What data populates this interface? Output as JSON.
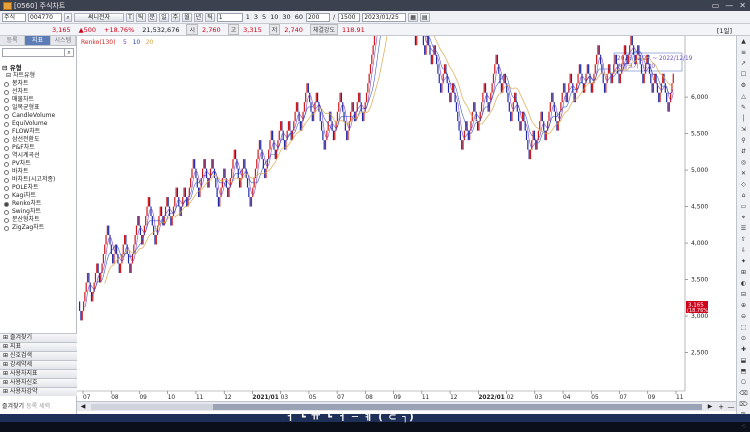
{
  "window": {
    "title": "[0560] 주식차트",
    "icon": "app-icon",
    "controls": [
      "▭",
      "—",
      "✕"
    ]
  },
  "toolbar1": {
    "market": "주식",
    "code": "004770",
    "search_icon": "search-icon",
    "buttons": [
      "T",
      "틱",
      "분",
      "일",
      "주",
      "월",
      "년",
      "틱"
    ],
    "minutes": [
      "1",
      "3",
      "5",
      "10",
      "30",
      "60"
    ],
    "count": "200",
    "total": "1500",
    "date": "2023/01/25"
  },
  "quote": {
    "name": "써니전자",
    "price": "3,165",
    "change": "▲500",
    "change_pct": "+18.76%",
    "volume": "21,532,676",
    "open_label": "시",
    "open": "2,760",
    "high_label": "고",
    "high": "3,315",
    "low_label": "저",
    "low": "2,740",
    "strength_label": "체결강도",
    "strength": "118.91",
    "period": "[1일]"
  },
  "leftpanel": {
    "tabs": [
      "등록",
      "지표",
      "시스템"
    ],
    "active_tab": 1,
    "tree_root": "유형",
    "tree_folder": "차트유형",
    "items": [
      "봉차트",
      "선차트",
      "매물차트",
      "일목균형표",
      "CandleVolume",
      "EquiVolume",
      "FLOW차트",
      "삼선전환도",
      "P&F차트",
      "역시계곡선",
      "PV차트",
      "바차트",
      "바차트(시고저종)",
      "POLE차트",
      "Kagi차트",
      "Renko차트",
      "Swing차트",
      "분산형차트",
      "ZigZag차트"
    ],
    "selected_item": "Renko차트",
    "sections": [
      "즐겨찾기",
      "지표",
      "신호검색",
      "강세약세",
      "사용자지표",
      "사용자신호",
      "사용자강약"
    ],
    "bottom_tabs": [
      "즐겨찾기",
      "등록",
      "세력"
    ]
  },
  "chart_data": {
    "type": "renko",
    "legend": [
      {
        "label": "Renko(130)",
        "color": "#cc2222"
      },
      {
        "label": "5",
        "color": "#7a3fc0"
      },
      {
        "label": "10",
        "color": "#1f3fbf"
      },
      {
        "label": "20",
        "color": "#d9a54a"
      }
    ],
    "info_box": {
      "range": "2016/12/27 ~ 2022/12/19",
      "brick_label": "벽돌크기 : 130"
    },
    "brick_size": 130,
    "ylim": [
      2000,
      6700
    ],
    "yticks": [
      "6,000",
      "5,500",
      "5,000",
      "4,500",
      "4,000",
      "3,500",
      "3,000",
      "2,500"
    ],
    "current_price_tag": [
      "3,165",
      "(18.76%)"
    ],
    "xticks": [
      "07",
      "08",
      "09",
      "10",
      "11",
      "12",
      "2021/01",
      "03",
      "05",
      "07",
      "08",
      "09",
      "11",
      "12",
      "2022/01",
      "02",
      "03",
      "04",
      "05",
      "07",
      "09",
      "11"
    ],
    "bold_xticks": [
      "2021/01",
      "2022/01"
    ],
    "moves": [
      -2,
      5,
      -3,
      4,
      -2,
      6,
      -4,
      2,
      -3,
      4,
      -4,
      6,
      -3,
      5,
      -5,
      4,
      -2,
      3,
      -3,
      4,
      -3,
      3,
      -2,
      5,
      -4,
      4,
      -3,
      3,
      -5,
      4,
      -3,
      5,
      -4,
      3,
      -5,
      7,
      -4,
      5,
      -3,
      4,
      -3,
      3,
      -2,
      4,
      -3,
      5,
      -4,
      3,
      -6,
      4,
      -3,
      5,
      -5,
      4,
      -2,
      3,
      -3,
      19,
      -3,
      2,
      -6,
      3,
      -7,
      3,
      -4,
      2,
      -3,
      2,
      -5,
      3,
      -4,
      2,
      -7,
      3,
      -2,
      4,
      -3,
      5,
      -3,
      6,
      -4,
      2,
      -5,
      3,
      -4,
      2,
      -5,
      3,
      -2,
      4,
      -3,
      5,
      -4,
      5,
      -2,
      3,
      -3,
      4,
      -3,
      3,
      -3,
      5,
      -5,
      3,
      -2,
      3,
      -3,
      4,
      -2,
      3,
      -3,
      2,
      -4,
      3,
      -4,
      2,
      -3,
      3,
      -4,
      4
    ]
  },
  "scroll": {
    "left": "◀",
    "right": "▶",
    "zoom_in": "+",
    "zoom_out": "—"
  },
  "rightbar": {
    "icons": [
      "▲",
      "≡",
      "↗",
      "☐",
      "⚙",
      "△",
      "✎",
      "│",
      "⇲",
      "⚲",
      "⇵",
      "◎",
      "✕",
      "◇",
      "⌂",
      "▭",
      "⌖",
      "☰",
      "⇧",
      "⇩",
      "✦",
      "⊞",
      "◐",
      "⊟",
      "⊕",
      "⊖",
      "⬚",
      "⊙",
      "✚",
      "⬓",
      "⬒",
      "⎔",
      "⌫",
      "⌦",
      "⎘",
      "⟲"
    ]
  },
  "taskbar": {
    "caption": "ㅓ ┗ ㅠ ┗ ㅓ ─ ㅖ ( ⊂ ┐)"
  }
}
